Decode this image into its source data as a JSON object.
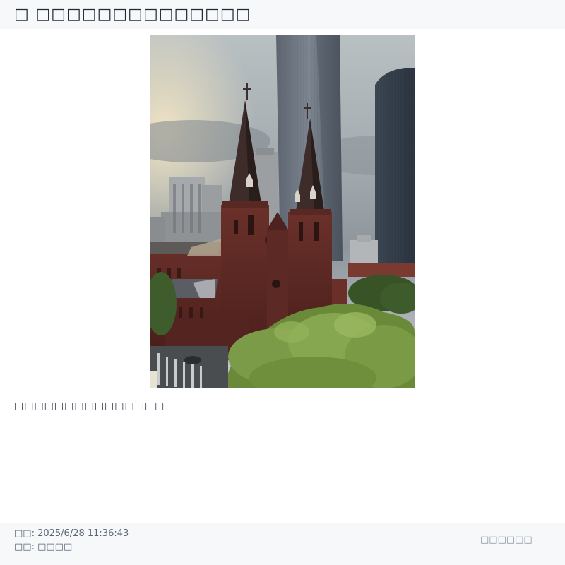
{
  "header": {
    "title": "□ □□□□□□□□□□□□□□"
  },
  "post": {
    "caption": "□□□□□□□□□□□□□□□"
  },
  "footer": {
    "time_label": "□□",
    "time_value": "2025/6/28 11:36:43",
    "author_label": "□□",
    "author_value": "□□□□",
    "link_label": "□□□□□□"
  }
}
